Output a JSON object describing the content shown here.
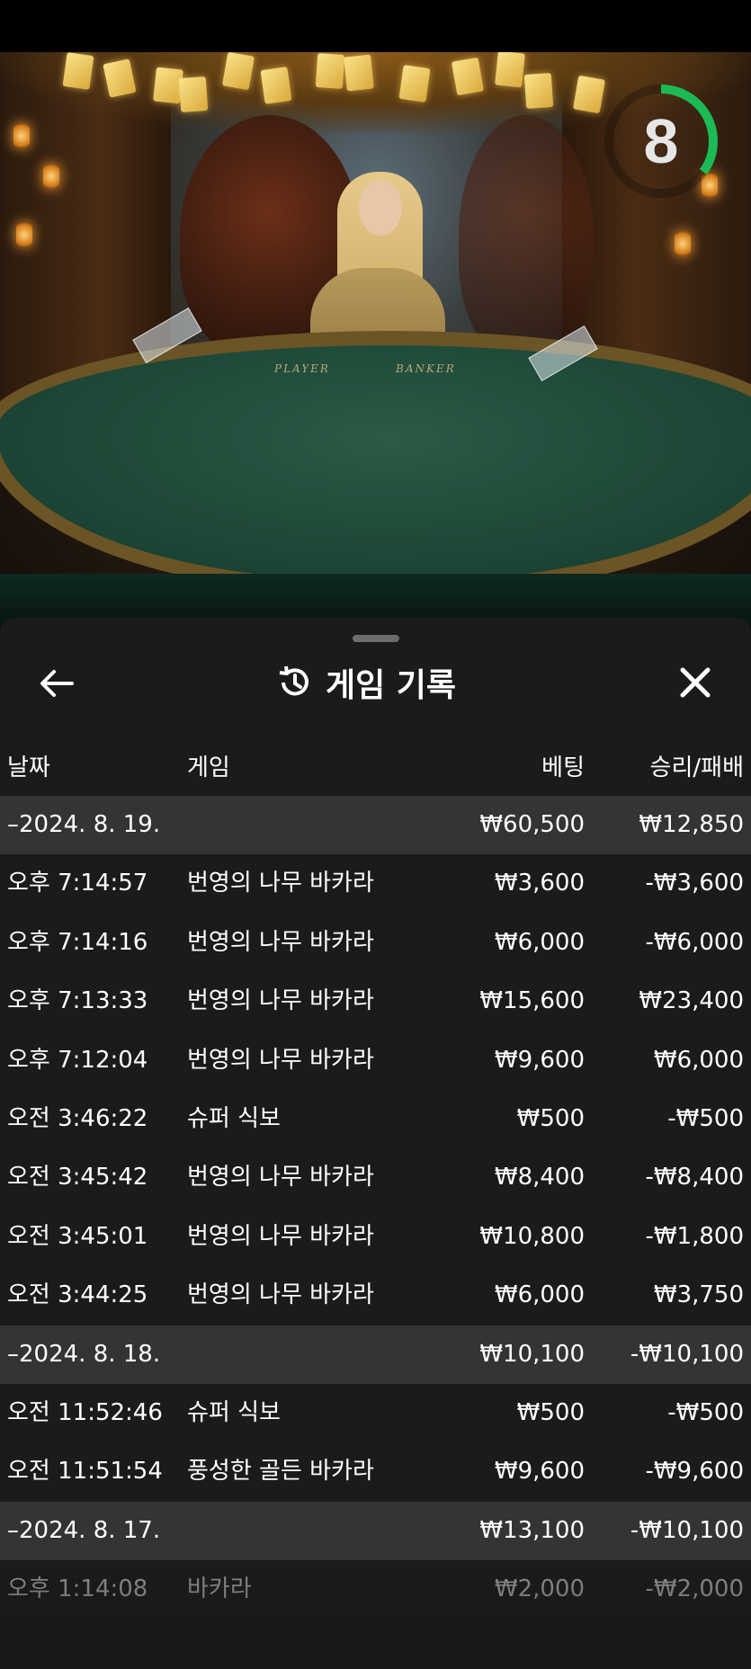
{
  "video": {
    "timer_value": "8",
    "timer_progress": 0.35,
    "table_label_left": "PLAYER",
    "table_label_right": "BANKER"
  },
  "panel": {
    "title": "게임 기록",
    "back_icon": "arrow-left-icon",
    "history_icon": "history-icon",
    "close_icon": "close-icon",
    "columns": {
      "date": "날짜",
      "game": "게임",
      "bet": "베팅",
      "win_loss": "승리/패배"
    },
    "rows": [
      {
        "type": "day",
        "date": "–2024. 8. 19.",
        "game": "",
        "bet": "₩60,500",
        "win": "₩12,850"
      },
      {
        "type": "entry",
        "date": "오후 7:14:57",
        "game": "번영의 나무 바카라",
        "bet": "₩3,600",
        "win": "-₩3,600"
      },
      {
        "type": "entry",
        "date": "오후 7:14:16",
        "game": "번영의 나무 바카라",
        "bet": "₩6,000",
        "win": "-₩6,000"
      },
      {
        "type": "entry",
        "date": "오후 7:13:33",
        "game": "번영의 나무 바카라",
        "bet": "₩15,600",
        "win": "₩23,400"
      },
      {
        "type": "entry",
        "date": "오후 7:12:04",
        "game": "번영의 나무 바카라",
        "bet": "₩9,600",
        "win": "₩6,000"
      },
      {
        "type": "entry",
        "date": "오전 3:46:22",
        "game": "슈퍼 식보",
        "bet": "₩500",
        "win": "-₩500"
      },
      {
        "type": "entry",
        "date": "오전 3:45:42",
        "game": "번영의 나무 바카라",
        "bet": "₩8,400",
        "win": "-₩8,400"
      },
      {
        "type": "entry",
        "date": "오전 3:45:01",
        "game": "번영의 나무 바카라",
        "bet": "₩10,800",
        "win": "-₩1,800"
      },
      {
        "type": "entry",
        "date": "오전 3:44:25",
        "game": "번영의 나무 바카라",
        "bet": "₩6,000",
        "win": "₩3,750"
      },
      {
        "type": "day",
        "date": "–2024. 8. 18.",
        "game": "",
        "bet": "₩10,100",
        "win": "-₩10,100"
      },
      {
        "type": "entry",
        "date": "오전 11:52:46",
        "game": "슈퍼 식보",
        "bet": "₩500",
        "win": "-₩500"
      },
      {
        "type": "entry",
        "date": "오전 11:51:54",
        "game": "풍성한 골든 바카라",
        "bet": "₩9,600",
        "win": "-₩9,600"
      },
      {
        "type": "day",
        "date": "–2024. 8. 17.",
        "game": "",
        "bet": "₩13,100",
        "win": "-₩10,100"
      },
      {
        "type": "entry",
        "date": "오후 1:14:08",
        "game": "바카라",
        "bet": "₩2,000",
        "win": "-₩2,000"
      }
    ]
  },
  "colors": {
    "panel_bg": "#1c1c1e",
    "day_row_bg": "#343434",
    "timer_green": "#1db954",
    "text": "#ffffff"
  }
}
